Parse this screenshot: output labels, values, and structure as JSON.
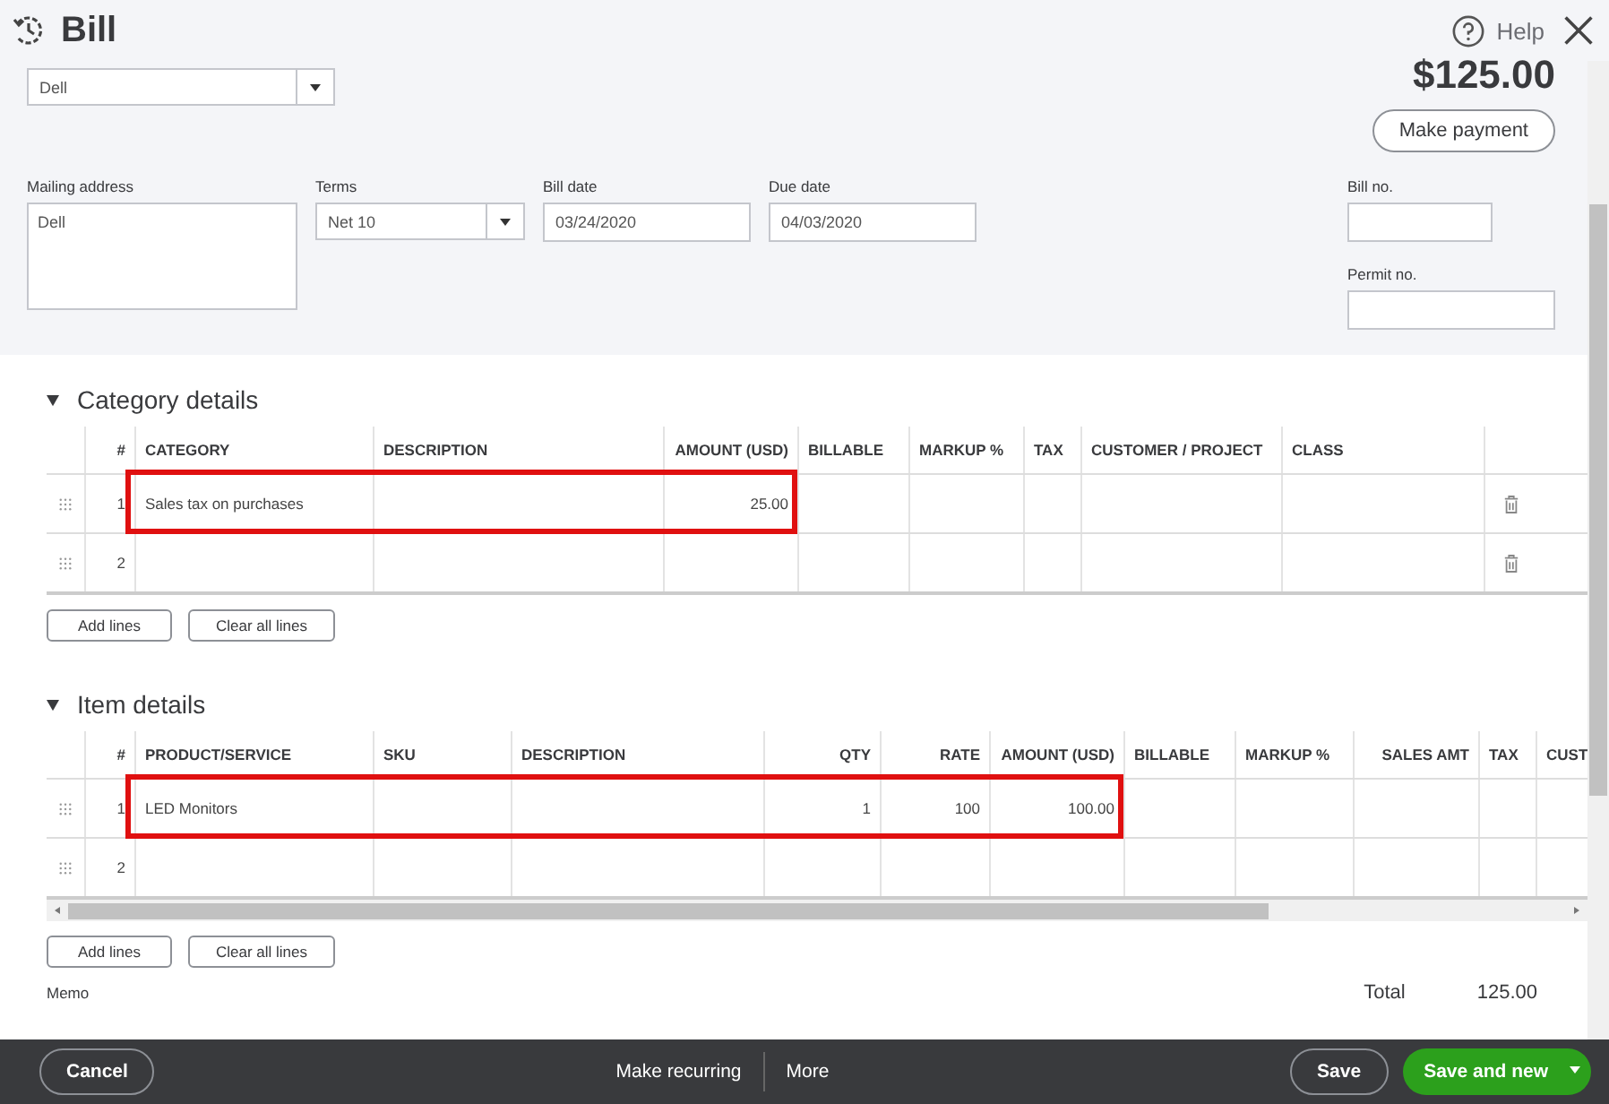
{
  "header": {
    "title": "Bill",
    "help": "Help"
  },
  "vendor": {
    "value": "Dell"
  },
  "balance": {
    "amount": "$125.00",
    "button": "Make payment"
  },
  "fields": {
    "mailing_address": {
      "label": "Mailing address",
      "value": "Dell"
    },
    "terms": {
      "label": "Terms",
      "value": "Net 10"
    },
    "bill_date": {
      "label": "Bill date",
      "value": "03/24/2020"
    },
    "due_date": {
      "label": "Due date",
      "value": "04/03/2020"
    },
    "bill_no": {
      "label": "Bill no."
    },
    "permit_no": {
      "label": "Permit no."
    }
  },
  "sections": [
    {
      "title": "Category details",
      "expanded": true,
      "columns": [
        "#",
        "CATEGORY",
        "DESCRIPTION",
        "AMOUNT (USD)",
        "BILLABLE",
        "MARKUP %",
        "TAX",
        "CUSTOMER / PROJECT",
        "CLASS"
      ],
      "rows": [
        {
          "highlighted": true,
          "cells": [
            "1",
            "Sales tax on purchases",
            "",
            "25.00",
            "",
            "",
            "",
            "",
            ""
          ]
        },
        {
          "highlighted": false,
          "cells": [
            "2",
            "",
            "",
            "",
            "",
            "",
            "",
            "",
            ""
          ]
        }
      ],
      "buttons": [
        "Add lines",
        "Clear all lines"
      ]
    },
    {
      "title": "Item details",
      "expanded": true,
      "columns": [
        "#",
        "PRODUCT/SERVICE",
        "SKU",
        "DESCRIPTION",
        "QTY",
        "RATE",
        "AMOUNT (USD)",
        "BILLABLE",
        "MARKUP %",
        "SALES AMT",
        "TAX",
        "CUST"
      ],
      "rows": [
        {
          "highlighted": true,
          "cells": [
            "1",
            "LED Monitors",
            "",
            "",
            "1",
            "100",
            "100.00",
            "",
            "",
            "",
            "",
            ""
          ]
        },
        {
          "highlighted": false,
          "cells": [
            "2",
            "",
            "",
            "",
            "",
            "",
            "",
            "",
            "",
            "",
            "",
            ""
          ]
        }
      ],
      "buttons": [
        "Add lines",
        "Clear all lines"
      ]
    }
  ],
  "memo": {
    "label": "Memo"
  },
  "total": {
    "label": "Total",
    "value": "125.00"
  },
  "footer": {
    "cancel": "Cancel",
    "make_recurring": "Make recurring",
    "more": "More",
    "save": "Save",
    "save_and_new": "Save and new"
  }
}
